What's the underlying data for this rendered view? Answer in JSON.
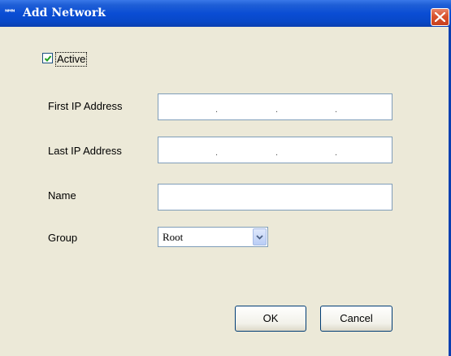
{
  "window": {
    "title": "Add Network",
    "app_icon": "ᴺᴹᴺ"
  },
  "form": {
    "active_label": "Active",
    "active_checked": true,
    "first_ip_label": "First IP Address",
    "last_ip_label": "Last IP Address",
    "name_label": "Name",
    "group_label": "Group",
    "first_ip_value": "",
    "last_ip_value": "",
    "name_value": "",
    "group_selected": "Root"
  },
  "buttons": {
    "ok_label": "OK",
    "cancel_label": "Cancel"
  },
  "colors": {
    "titlebar": "#0a4dd4",
    "background": "#ece9d8",
    "close": "#d9532f",
    "check": "#21a121"
  }
}
